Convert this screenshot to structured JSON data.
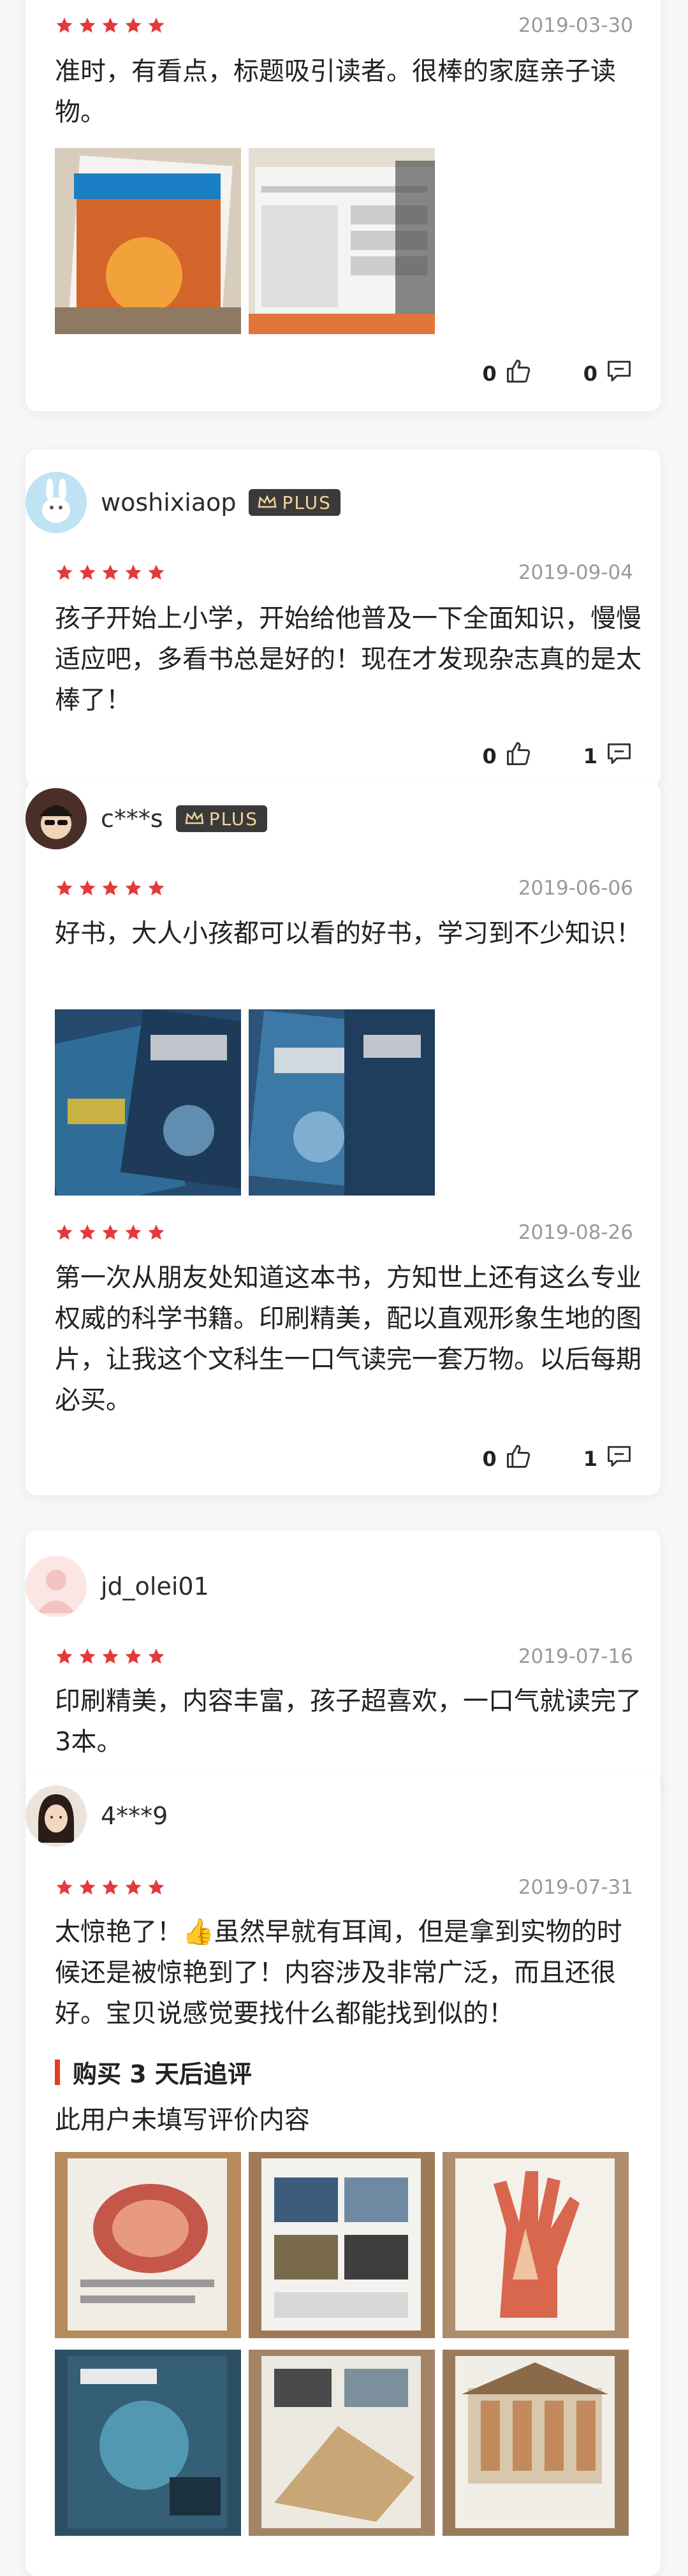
{
  "reviews": [
    {
      "date": "2019-03-30",
      "text": "准时，有看点，标题吸引读者。很棒的家庭亲子读物。",
      "likes": "0",
      "comments": "0"
    },
    {
      "username": "woshixiaop",
      "badge": "PLUS",
      "date": "2019-09-04",
      "text": "孩子开始上小学，开始给他普及一下全面知识，慢慢适应吧，多看书总是好的！现在才发现杂志真的是太棒了！",
      "likes": "0",
      "comments": "1"
    },
    {
      "username": "c***s",
      "badge": "PLUS",
      "date": "2019-06-06",
      "text": "好书，大人小孩都可以看的好书，学习到不少知识！",
      "followup_date": "2019-08-26",
      "followup_text": "第一次从朋友处知道这本书，方知世上还有这么专业权威的科学书籍。印刷精美，配以直观形象生地的图片，让我这个文科生一口气读完一套万物。以后每期必买。",
      "likes": "0",
      "comments": "1"
    },
    {
      "username": "jd_olei01",
      "date": "2019-07-16",
      "text": "印刷精美，内容丰富，孩子超喜欢，一口气就读完了3本。"
    },
    {
      "username": "4***9",
      "date": "2019-07-31",
      "text": "太惊艳了！👍虽然早就有耳闻，但是拿到实物的时候还是被惊艳到了！内容涉及非常广泛，而且还很好。宝贝说感觉要找什么都能找到似的！",
      "followup_title": "购买 3 天后追评",
      "followup_text": "此用户未填写评价内容"
    }
  ],
  "colors": {
    "star": "#e4393c",
    "plus_text": "#f2d49a",
    "accent": "#e43c1f"
  },
  "icons": {
    "like": "thumbs-up-icon",
    "comment": "comment-icon",
    "plus": "crown-icon"
  }
}
